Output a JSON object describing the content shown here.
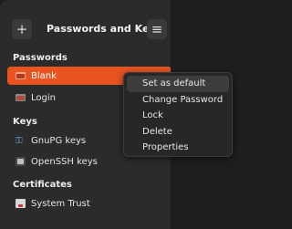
{
  "header": {
    "add_label": "+",
    "title": "Passwords and Keys",
    "menu_label": "≡"
  },
  "sidebar": {
    "sections": [
      {
        "title": "Passwords",
        "items": [
          {
            "label": "Blank",
            "active": true
          },
          {
            "label": "Login"
          }
        ]
      },
      {
        "title": "Keys",
        "items": [
          {
            "label": "GnuPG keys"
          },
          {
            "label": "OpenSSH keys"
          }
        ]
      },
      {
        "title": "Certificates",
        "items": [
          {
            "label": "System Trust"
          }
        ]
      }
    ]
  },
  "context_menu": {
    "items": [
      "Set as default",
      "Change Password",
      "Lock",
      "Delete",
      "Properties"
    ]
  },
  "colors": {
    "accent": "#e95420"
  }
}
